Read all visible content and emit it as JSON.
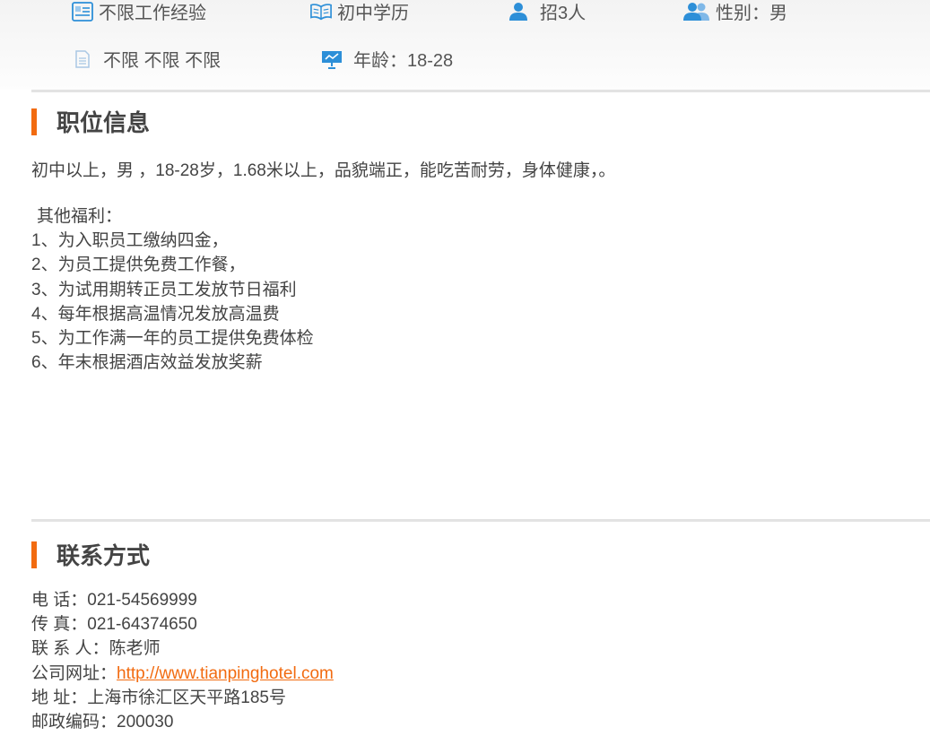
{
  "job_attributes": {
    "experience": "不限工作经验",
    "education": "初中学历",
    "headcount": "招3人",
    "gender": "性别：男",
    "misc": "不限 不限 不限",
    "age": "年龄：18-28"
  },
  "icons": {
    "experience": "resume-icon",
    "education": "book-icon",
    "headcount": "person-icon",
    "gender": "people-icon",
    "misc": "document-icon",
    "age": "presentation-board-icon"
  },
  "colors": {
    "accent": "#f26b10",
    "icon_blue": "#2d8fd8"
  },
  "position_info": {
    "title": "职位信息",
    "description": "初中以上，男 ，18-28岁，1.68米以上，品貌端正，能吃苦耐劳，身体健康，。",
    "benefits_heading": "其他福利：",
    "benefits": [
      "1、为入职员工缴纳四金，",
      "2、为员工提供免费工作餐，",
      "3、为试用期转正员工发放节日福利",
      "4、每年根据高温情况发放高温费",
      "5、为工作满一年的员工提供免费体检",
      "6、年末根据酒店效益发放奖薪"
    ]
  },
  "contact": {
    "title": "联系方式",
    "phone_label": "电 话：",
    "phone": "021-54569999",
    "fax_label": "传 真：",
    "fax": "021-64374650",
    "person_label": "联 系 人：",
    "person": "陈老师",
    "website_label": "公司网址：",
    "website": "http://www.tianpinghotel.com",
    "address_label": "地 址：",
    "address": "上海市徐汇区天平路185号",
    "postcode_label": "邮政编码：",
    "postcode": "200030"
  }
}
